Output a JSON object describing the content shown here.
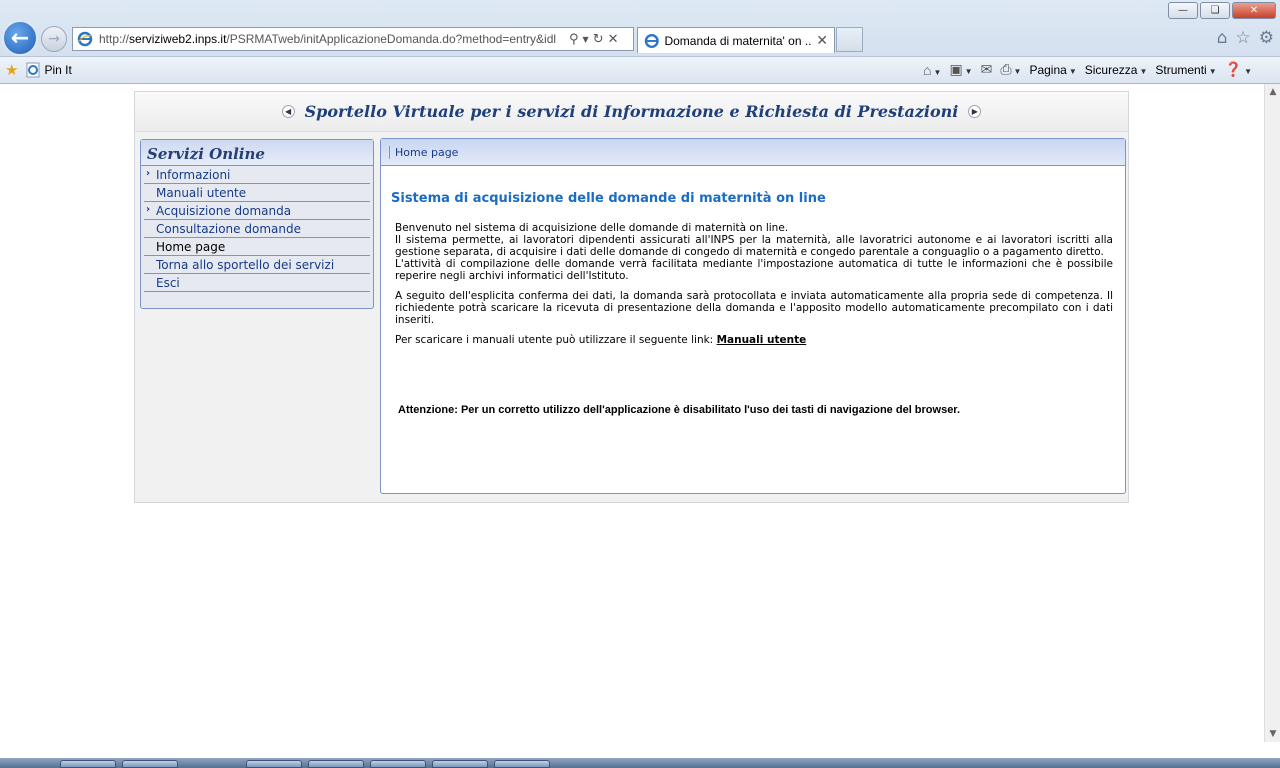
{
  "browser": {
    "url_prefix": "http://",
    "url_host": "serviziweb2.inps.it",
    "url_path": "/PSRMATweb/initApplicazioneDomanda.do?method=entry&idl",
    "tab_title": "Domanda di maternita' on ...",
    "pin_it": "Pin It",
    "menu_pagina": "Pagina",
    "menu_sicurezza": "Sicurezza",
    "menu_strumenti": "Strumenti"
  },
  "banner": {
    "title": "Sportello Virtuale per i servizi di Informazione e Richiesta di Prestazioni"
  },
  "sidebar": {
    "title": "Servizi Online",
    "items": [
      {
        "label": "Informazioni",
        "chevron": true
      },
      {
        "label": "Manuali utente",
        "chevron": false
      },
      {
        "label": "Acquisizione domanda",
        "chevron": true
      },
      {
        "label": "Consultazione domande",
        "chevron": false
      },
      {
        "label": "Home page",
        "chevron": false
      },
      {
        "label": "Torna allo sportello dei servizi",
        "chevron": false
      },
      {
        "label": "Esci",
        "chevron": false
      }
    ]
  },
  "content": {
    "breadcrumb": "Home page",
    "title": "Sistema di acquisizione delle domande di maternità on line",
    "p1_l1": "Benvenuto nel sistema di acquisizione delle domande di maternità on line.",
    "p1_l2": "Il sistema permette, ai lavoratori dipendenti assicurati all'INPS per la maternità, alle lavoratrici autonome e ai lavoratori iscritti alla gestione separata, di acquisire i dati delle domande di congedo di maternità e congedo parentale a conguaglio o a pagamento diretto.",
    "p1_l3": "L'attività di compilazione delle domande verrà facilitata mediante l'impostazione automatica di tutte le informazioni che è possibile reperire negli archivi informatici dell'Istituto.",
    "p2": "A seguito dell'esplicita conferma dei dati, la domanda sarà protocollata e inviata automaticamente alla propria sede di competenza. Il richiedente potrà scaricare la ricevuta di presentazione della domanda e l'apposito modello automaticamente precompilato con i dati inseriti.",
    "p3": "Per scaricare i manuali utente può utilizzare il seguente link:",
    "p3_link": "Manuali utente",
    "warning": "Attenzione: Per un corretto utilizzo dell'applicazione è disabilitato l'uso dei tasti di navigazione del browser."
  },
  "colors": {
    "title_blue": "#1a6cc4",
    "nav_blue": "#173b8a",
    "border_blue": "#7b95c8"
  }
}
